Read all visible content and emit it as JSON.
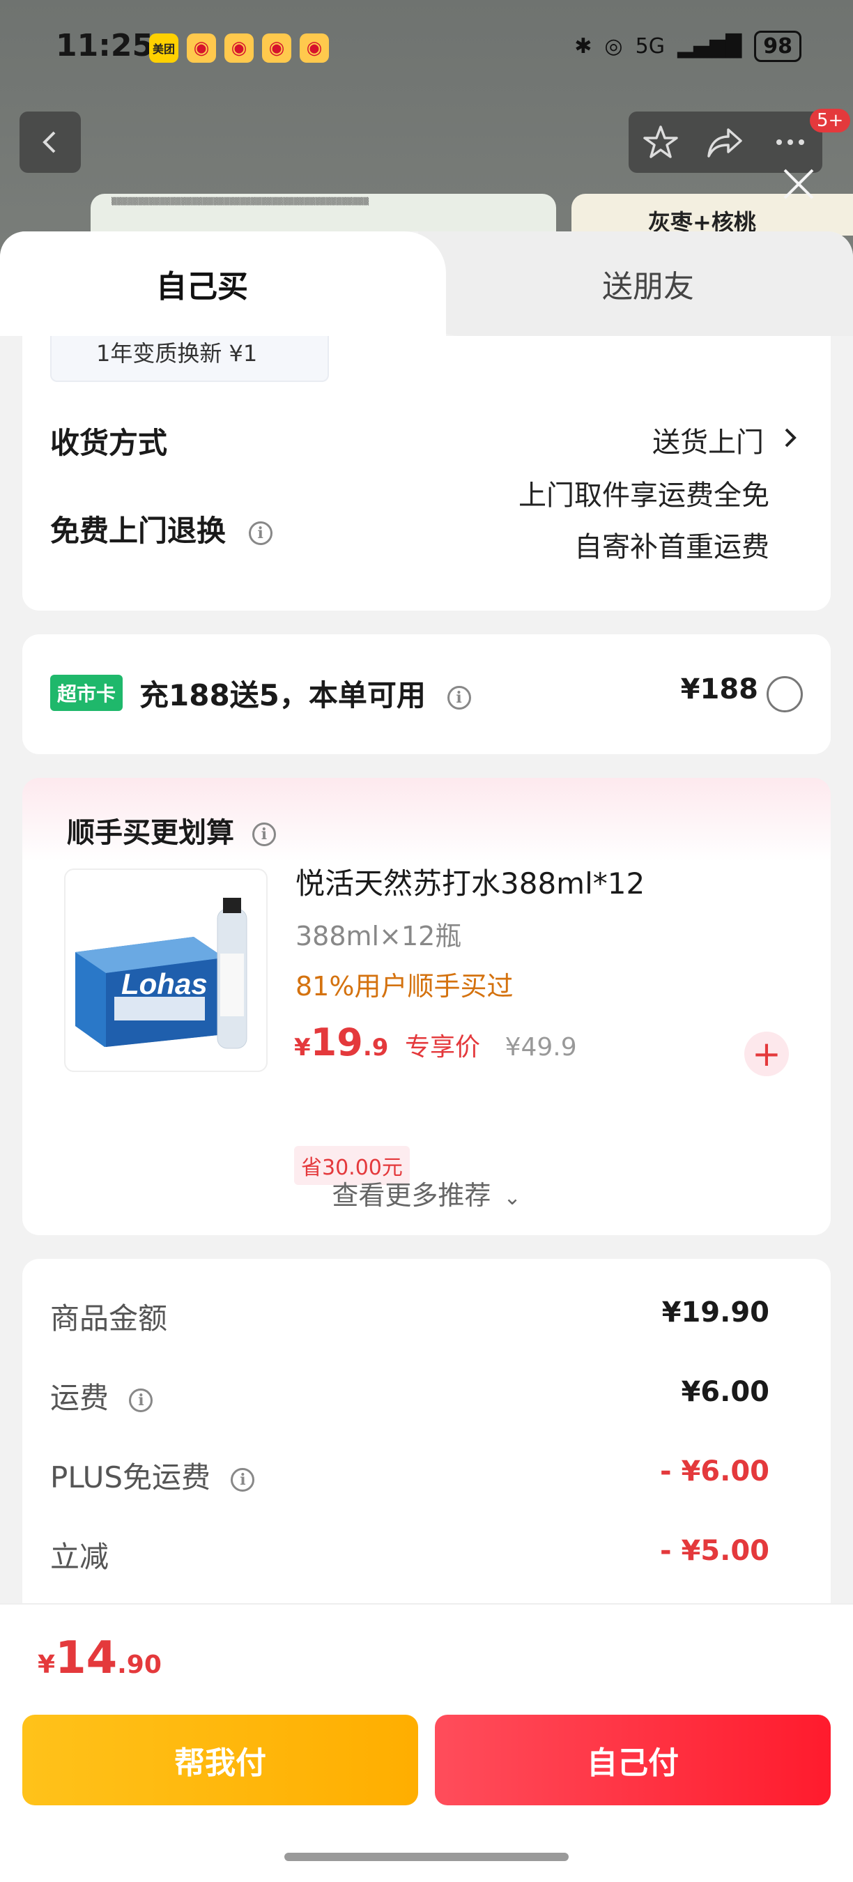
{
  "status_bar": {
    "time": "11:25",
    "battery": "98",
    "notifications": [
      "美团",
      "weibo",
      "weibo",
      "weibo",
      "weibo"
    ],
    "network": "5G"
  },
  "nav": {
    "badge": "5+",
    "banner_right": "灰枣+核桃"
  },
  "tabs": {
    "active": "自己买",
    "inactive": "送朋友"
  },
  "delivery_card": {
    "prev_item": "1年变质换新 ¥1",
    "shipping_label": "收货方式",
    "shipping_value": "送货上门",
    "return_label": "免费上门退换",
    "return_line1": "上门取件享运费全免",
    "return_line2": "自寄补首重运费"
  },
  "promo_card": {
    "chip": "超市卡",
    "text": "充188送5，本单可用",
    "price": "¥188"
  },
  "addon_card": {
    "title": "顺手买更划算",
    "product_name": "悦活天然苏打水388ml*12",
    "spec": "388ml×12瓶",
    "popularity": "81%用户顺手买过",
    "price_symbol": "¥",
    "price_int": "19",
    "price_dec": ".9",
    "price_label": "专享价",
    "original_price": "¥49.9",
    "save": "省30.00元",
    "more": "查看更多推荐",
    "image_brand": "Lohas"
  },
  "summary": {
    "rows": [
      {
        "label": "商品金额",
        "value": "¥19.90"
      },
      {
        "label": "运费",
        "value": "¥6.00"
      },
      {
        "label": "PLUS免运费",
        "value": "- ¥6.00"
      },
      {
        "label": "立减",
        "value": "- ¥5.00"
      }
    ]
  },
  "footer": {
    "total_symbol": "¥",
    "total_int": "14",
    "total_dec": ".90",
    "help_pay": "帮我付",
    "self_pay": "自己付"
  },
  "colors": {
    "accent": "#e4393c",
    "chip_green": "#1fb86b",
    "help_btn": "#ffb800",
    "self_btn": "#ff2d3f"
  }
}
